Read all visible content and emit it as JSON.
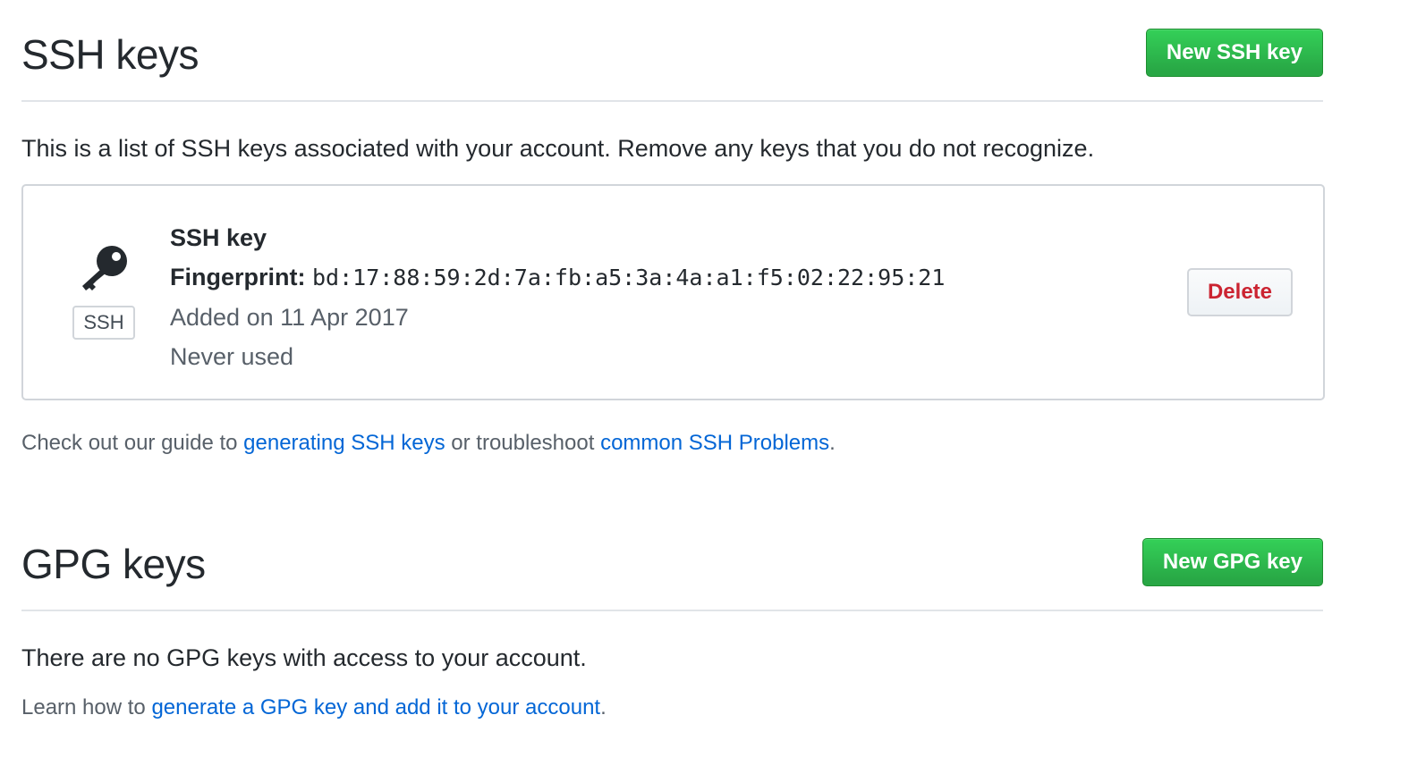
{
  "ssh": {
    "title": "SSH keys",
    "new_button": "New SSH key",
    "description": "This is a list of SSH keys associated with your account. Remove any keys that you do not recognize.",
    "key": {
      "badge": "SSH",
      "icon": "key-icon",
      "title": "SSH key",
      "fingerprint_label": "Fingerprint:",
      "fingerprint": "bd:17:88:59:2d:7a:fb:a5:3a:4a:a1:f5:02:22:95:21",
      "added": "Added on 11 Apr 2017",
      "usage": "Never used",
      "delete_button": "Delete"
    },
    "help": {
      "prefix": "Check out our guide to ",
      "link1": "generating SSH keys",
      "middle": " or troubleshoot ",
      "link2": "common SSH Problems",
      "suffix": "."
    }
  },
  "gpg": {
    "title": "GPG keys",
    "new_button": "New GPG key",
    "empty_message": "There are no GPG keys with access to your account.",
    "help": {
      "prefix": "Learn how to ",
      "link": "generate a GPG key and add it to your account",
      "suffix": "."
    }
  },
  "colors": {
    "primary_button": "#28a745",
    "danger_text": "#cb2431",
    "link": "#0366d6",
    "muted_text": "#586069"
  }
}
